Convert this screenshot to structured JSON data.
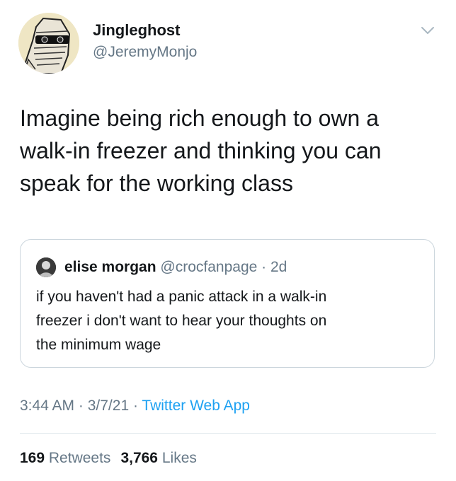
{
  "author": {
    "display_name": "Jingleghost",
    "handle": "@JeremyMonjo"
  },
  "tweet": {
    "lines": [
      "Imagine being rich enough to own a",
      "walk-in freezer and thinking you can",
      "speak for the working class"
    ]
  },
  "quoted_tweet": {
    "display_name": "elise morgan",
    "handle": "@crocfanpage",
    "separator": " · ",
    "age": "2d",
    "lines": [
      "if you haven't had a panic attack in a walk-in",
      "freezer i don't want to hear your thoughts on",
      "the minimum wage"
    ]
  },
  "meta": {
    "time": "3:44 AM",
    "separator": " · ",
    "date": "3/7/21",
    "source": "Twitter Web App"
  },
  "stats": {
    "retweets_count": "169",
    "retweets_label": "Retweets",
    "likes_count": "3,766",
    "likes_label": "Likes"
  },
  "icons": {
    "menu": "chevron-down-icon"
  },
  "colors": {
    "text_primary": "#14171a",
    "text_secondary": "#657786",
    "link": "#1da1f2",
    "border": "#ccd6dd"
  }
}
